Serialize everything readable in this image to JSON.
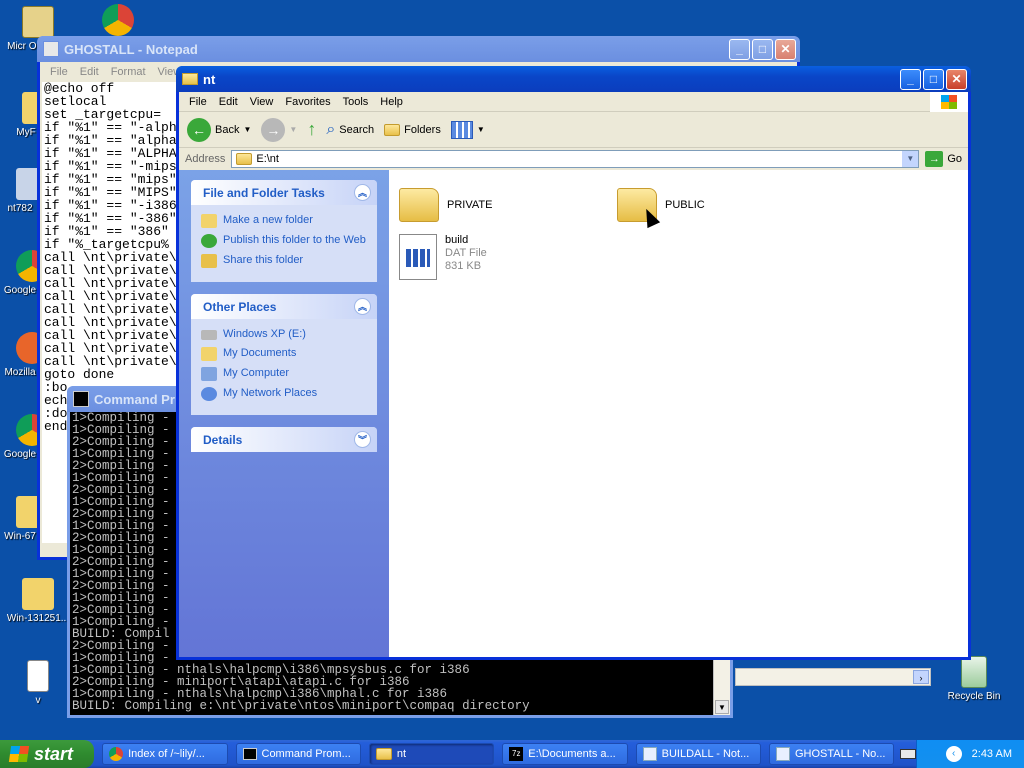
{
  "desktop_icons": [
    {
      "label": "Micr Out",
      "icon": "outlook-icon"
    },
    {
      "label": "MyF",
      "icon": "folder-icon"
    },
    {
      "label": "nt782",
      "icon": "computer-icon"
    },
    {
      "label": "Google",
      "icon": "chrome-icon"
    },
    {
      "label": "Mozilla",
      "icon": "firefox-icon"
    },
    {
      "label": "Google",
      "icon": "chrome-icon"
    },
    {
      "label": "Win-67",
      "icon": "folder-icon"
    },
    {
      "label": "Win-131251...",
      "icon": "folder-icon"
    },
    {
      "label": "v",
      "icon": "document-icon"
    },
    {
      "label": "Recycle Bin",
      "icon": "recycle-bin-icon"
    }
  ],
  "notepad": {
    "title": "GHOSTALL - Notepad",
    "menu": [
      "File",
      "Edit",
      "Format",
      "View"
    ],
    "text": "@echo off\nsetlocal\nset _targetcpu=\nif \"%1\" == \"-alph\nif \"%1\" == \"alpha\nif \"%1\" == \"ALPHA\nif \"%1\" == \"-mips\nif \"%1\" == \"mips\"\nif \"%1\" == \"MIPS\"\nif \"%1\" == \"-i386\nif \"%1\" == \"-386\"\nif \"%1\" == \"386\"\nif \"%_targetcpu%\ncall \\nt\\private\\\ncall \\nt\\private\\\ncall \\nt\\private\\\ncall \\nt\\private\\\ncall \\nt\\private\\\ncall \\nt\\private\\\ncall \\nt\\private\\\ncall \\nt\\private\\\ncall \\nt\\private\\\ngoto done\n:bo\nech\n:do\nend"
  },
  "cmd": {
    "title": "Command Pr",
    "text": "1>Compiling -\n1>Compiling -\n2>Compiling -\n1>Compiling -\n2>Compiling -\n1>Compiling -\n2>Compiling -\n1>Compiling -\n2>Compiling -\n1>Compiling -\n2>Compiling -\n1>Compiling -\n2>Compiling -\n1>Compiling -\n2>Compiling -\n1>Compiling -\n2>Compiling -\n1>Compiling -\nBUILD: Compil\n2>Compiling -\n1>Compiling -\n1>Compiling - nthals\\halpcmp\\i386\\mpsysbus.c for i386\n2>Compiling - miniport\\atapi\\atapi.c for i386\n1>Compiling - nthals\\halpcmp\\i386\\mphal.c for i386\nBUILD: Compiling e:\\nt\\private\\ntos\\miniport\\compaq directory"
  },
  "explorer": {
    "title": "nt",
    "menu": [
      "File",
      "Edit",
      "View",
      "Favorites",
      "Tools",
      "Help"
    ],
    "toolbar": {
      "back": "Back",
      "search": "Search",
      "folders": "Folders"
    },
    "address_label": "Address",
    "address_value": "E:\\nt",
    "go_label": "Go",
    "tasks": {
      "title": "File and Folder Tasks",
      "items": [
        "Make a new folder",
        "Publish this folder to the Web",
        "Share this folder"
      ]
    },
    "other_places": {
      "title": "Other Places",
      "items": [
        "Windows XP (E:)",
        "My Documents",
        "My Computer",
        "My Network Places"
      ]
    },
    "details": {
      "title": "Details"
    },
    "files": [
      {
        "name": "PRIVATE",
        "type": "folder"
      },
      {
        "name": "PUBLIC",
        "type": "folder"
      },
      {
        "name": "build",
        "kind": "DAT File",
        "size": "831 KB",
        "type": "file"
      }
    ]
  },
  "taskbar": {
    "start_label": "start",
    "tasks": [
      {
        "label": "Index of /~lily/...",
        "icon": "chrome-icon"
      },
      {
        "label": "Command Prom...",
        "icon": "cmd-icon"
      },
      {
        "label": "nt",
        "icon": "folder-icon",
        "active": true
      },
      {
        "label": "E:\\Documents a...",
        "icon": "7zip-icon"
      },
      {
        "label": "BUILDALL - Not...",
        "icon": "notepad-icon"
      },
      {
        "label": "GHOSTALL - No...",
        "icon": "notepad-icon"
      }
    ],
    "clock": "2:43 AM"
  }
}
